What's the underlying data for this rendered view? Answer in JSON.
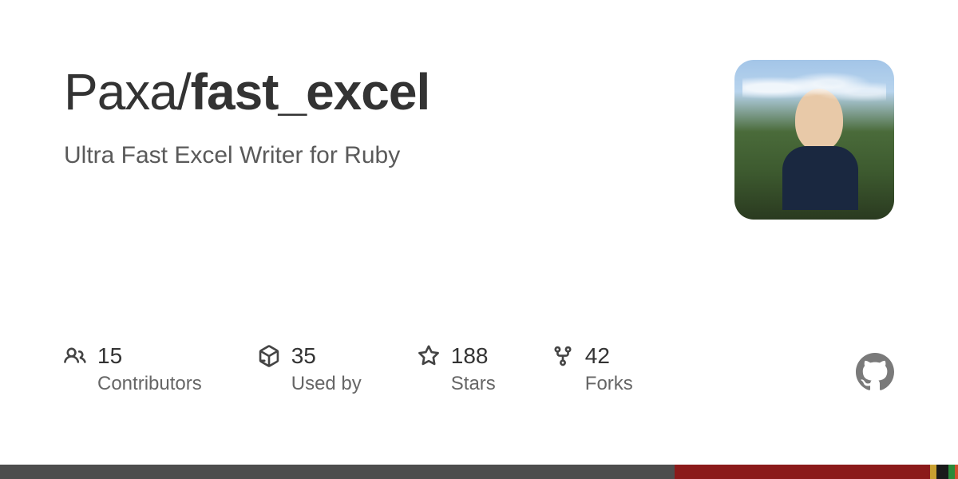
{
  "repo": {
    "owner": "Paxa",
    "name": "fast_excel",
    "description": "Ultra Fast Excel Writer for Ruby"
  },
  "stats": {
    "contributors": {
      "value": "15",
      "label": "Contributors"
    },
    "usedby": {
      "value": "35",
      "label": "Used by"
    },
    "stars": {
      "value": "188",
      "label": "Stars"
    },
    "forks": {
      "value": "42",
      "label": "Forks"
    }
  }
}
